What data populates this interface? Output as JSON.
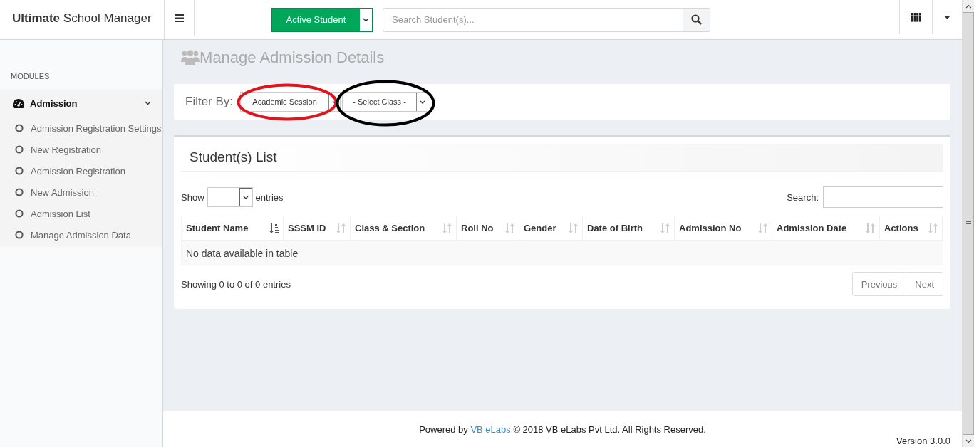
{
  "header": {
    "brand": "**Ultimate** School Manager",
    "status_button": {
      "label": "Active Student"
    },
    "search": {
      "placeholder": "Search Student(s)..."
    }
  },
  "sidebar": {
    "section": "MODULES",
    "menu": {
      "label": "Admission",
      "expanded": true,
      "children": [
        {
          "label": "Admission Registration Settings"
        },
        {
          "label": "New Registration"
        },
        {
          "label": "Admission Registration"
        },
        {
          "label": "New Admission"
        },
        {
          "label": "Admission List"
        },
        {
          "label": "Manage Admission Data"
        }
      ]
    }
  },
  "page_title": "Manage Admission Details",
  "filter": {
    "label": "Filter By:",
    "selects": [
      {
        "value": "Academic Session"
      },
      {
        "value": "- Select Class -"
      }
    ]
  },
  "annotations": [
    {
      "color": "#e0141e"
    },
    {
      "color": "#000000"
    }
  ],
  "list_card": {
    "title": "Student(s) List",
    "length_before": "Show",
    "length_after": "entries",
    "search_label": "Search:",
    "columns": [
      {
        "label": "Student Name",
        "sorted": true
      },
      {
        "label": "SSSM ID",
        "sorted": false
      },
      {
        "label": "Class & Section",
        "sorted": false
      },
      {
        "label": "Roll No",
        "sorted": false
      },
      {
        "label": "Gender",
        "sorted": false
      },
      {
        "label": "Date of Birth",
        "sorted": false
      },
      {
        "label": "Admission No",
        "sorted": false
      },
      {
        "label": "Admission Date",
        "sorted": false
      },
      {
        "label": "Actions",
        "sorted": false
      }
    ],
    "empty": "No data available in table",
    "info": "Showing 0 to 0 of 0 entries",
    "pagination": [
      "Previous",
      "Next"
    ]
  },
  "footer": {
    "prefix": "Powered by",
    "link": "VB eLabs",
    "rest": "© 2018 VB eLabs Pvt Ltd. All Rights Reserved.",
    "version": "Version 3.0.0"
  }
}
